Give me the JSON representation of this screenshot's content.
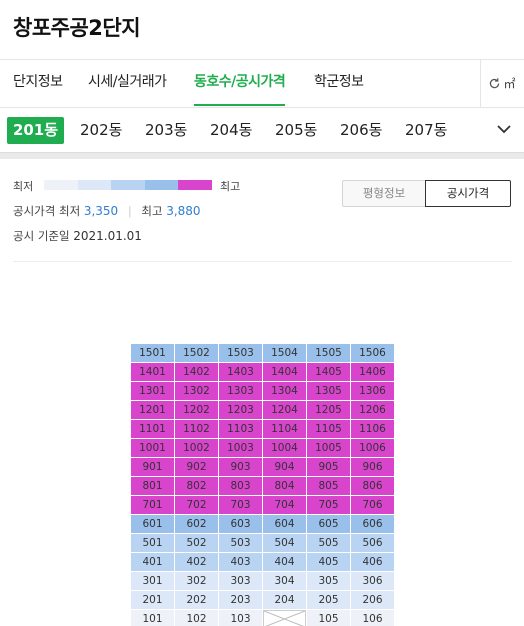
{
  "title": "창포주공2단지",
  "tabs": [
    {
      "label": "단지정보",
      "active": false
    },
    {
      "label": "시세/실거래가",
      "active": false
    },
    {
      "label": "동호수/공시가격",
      "active": true
    },
    {
      "label": "학군정보",
      "active": false
    }
  ],
  "unit_toggle": {
    "label": "㎡",
    "icon": "refresh-icon"
  },
  "dongs": [
    {
      "label": "201동",
      "active": true
    },
    {
      "label": "202동"
    },
    {
      "label": "203동"
    },
    {
      "label": "204동"
    },
    {
      "label": "205동"
    },
    {
      "label": "206동"
    },
    {
      "label": "207동"
    }
  ],
  "legend": {
    "low": "최저",
    "high": "최고",
    "colors": [
      "#eef2f8",
      "#dce8f8",
      "#b9d4f2",
      "#98c0ea",
      "#d944cc"
    ]
  },
  "price_info": {
    "label": "공시가격",
    "min_label": "최저",
    "min_value": "3,350",
    "max_label": "최고",
    "max_value": "3,880",
    "date_label": "공시 기준일",
    "date_value": "2021.01.01"
  },
  "toggle_buttons": {
    "area": "평형정보",
    "price": "공시가격"
  },
  "colors": {
    "level1": "#eef2f8",
    "level2": "#dce8f8",
    "level3": "#b9d4f2",
    "level4": "#98c0ea",
    "level5": "#d944cc",
    "accent": "#1fad4f"
  },
  "floors": [
    {
      "units": [
        "1501",
        "1502",
        "1503",
        "1504",
        "1505",
        "1506"
      ],
      "level": 4
    },
    {
      "units": [
        "1401",
        "1402",
        "1403",
        "1404",
        "1405",
        "1406"
      ],
      "level": 5
    },
    {
      "units": [
        "1301",
        "1302",
        "1303",
        "1304",
        "1305",
        "1306"
      ],
      "level": 5
    },
    {
      "units": [
        "1201",
        "1202",
        "1203",
        "1204",
        "1205",
        "1206"
      ],
      "level": 5
    },
    {
      "units": [
        "1101",
        "1102",
        "1103",
        "1104",
        "1105",
        "1106"
      ],
      "level": 5
    },
    {
      "units": [
        "1001",
        "1002",
        "1003",
        "1004",
        "1005",
        "1006"
      ],
      "level": 5
    },
    {
      "units": [
        "901",
        "902",
        "903",
        "904",
        "905",
        "906"
      ],
      "level": 5
    },
    {
      "units": [
        "801",
        "802",
        "803",
        "804",
        "805",
        "806"
      ],
      "level": 5
    },
    {
      "units": [
        "701",
        "702",
        "703",
        "704",
        "705",
        "706"
      ],
      "level": 5
    },
    {
      "units": [
        "601",
        "602",
        "603",
        "604",
        "605",
        "606"
      ],
      "level": 4
    },
    {
      "units": [
        "501",
        "502",
        "503",
        "504",
        "505",
        "506"
      ],
      "level": 3
    },
    {
      "units": [
        "401",
        "402",
        "403",
        "404",
        "405",
        "406"
      ],
      "level": 3
    },
    {
      "units": [
        "301",
        "302",
        "303",
        "304",
        "305",
        "306"
      ],
      "level": 2
    },
    {
      "units": [
        "201",
        "202",
        "203",
        "204",
        "205",
        "206"
      ],
      "level": 2
    },
    {
      "units": [
        "101",
        "102",
        "103",
        "",
        "105",
        "106"
      ],
      "level": 1
    }
  ]
}
